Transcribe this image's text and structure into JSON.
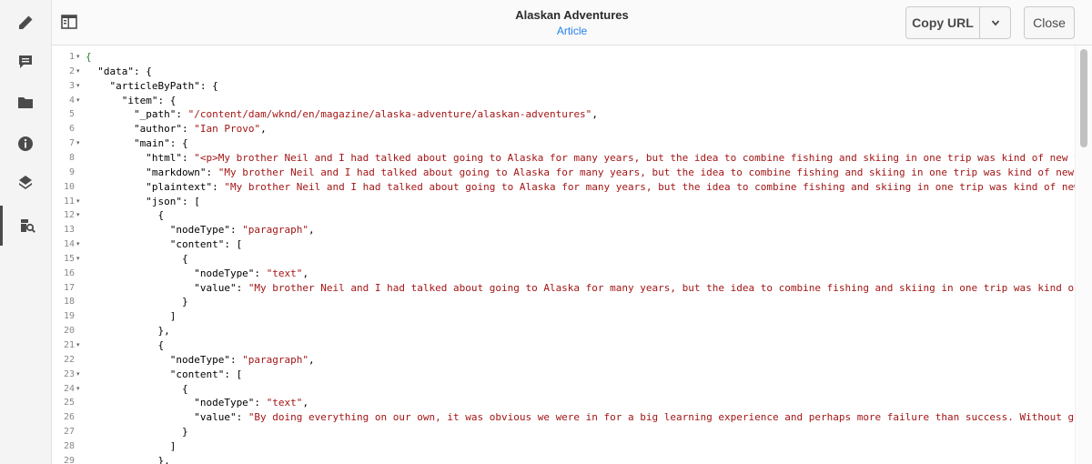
{
  "header": {
    "title": "Alaskan Adventures",
    "subtitle": "Article",
    "copy_url_label": "Copy URL",
    "close_label": "Close"
  },
  "rail": {
    "items": [
      {
        "name": "edit",
        "icon": "pencil-icon"
      },
      {
        "name": "annotations",
        "icon": "comment-icon"
      },
      {
        "name": "assets",
        "icon": "folder-icon"
      },
      {
        "name": "info",
        "icon": "info-icon"
      },
      {
        "name": "layers",
        "icon": "layers-icon"
      },
      {
        "name": "query-preview",
        "icon": "query-search-icon",
        "active": true
      }
    ]
  },
  "code": {
    "lines": [
      {
        "n": "1",
        "fold": true,
        "segs": [
          [
            "{",
            "g"
          ]
        ]
      },
      {
        "n": "2",
        "fold": true,
        "segs": [
          [
            "  \"data\": {",
            ""
          ]
        ]
      },
      {
        "n": "3",
        "fold": true,
        "segs": [
          [
            "    \"articleByPath\": {",
            ""
          ]
        ]
      },
      {
        "n": "4",
        "fold": true,
        "segs": [
          [
            "      \"item\": {",
            ""
          ]
        ]
      },
      {
        "n": "5",
        "fold": false,
        "segs": [
          [
            "        \"_path\": ",
            ""
          ],
          [
            "\"/content/dam/wknd/en/magazine/alaska-adventure/alaskan-adventures\"",
            "s"
          ],
          [
            ",",
            ""
          ]
        ]
      },
      {
        "n": "6",
        "fold": false,
        "segs": [
          [
            "        \"author\": ",
            ""
          ],
          [
            "\"Ian Provo\"",
            "s"
          ],
          [
            ",",
            ""
          ]
        ]
      },
      {
        "n": "7",
        "fold": true,
        "segs": [
          [
            "        \"main\": {",
            ""
          ]
        ]
      },
      {
        "n": "8",
        "fold": false,
        "segs": [
          [
            "          \"html\": ",
            ""
          ],
          [
            "\"<p>My brother Neil and I had talked about going to Alaska for many years, but the idea to combine fishing and skiing in one trip was kind of new to us. For t",
            "s"
          ]
        ]
      },
      {
        "n": "9",
        "fold": false,
        "segs": [
          [
            "          \"markdown\": ",
            ""
          ],
          [
            "\"My brother Neil and I had talked about going to Alaska for many years, but the idea to combine fishing and skiing in one trip was kind of new to us. For",
            "s"
          ]
        ]
      },
      {
        "n": "10",
        "fold": false,
        "segs": [
          [
            "          \"plaintext\": ",
            ""
          ],
          [
            "\"My brother Neil and I had talked about going to Alaska for many years, but the idea to combine fishing and skiing in one trip was kind of new to us. For",
            "s"
          ]
        ]
      },
      {
        "n": "11",
        "fold": true,
        "segs": [
          [
            "          \"json\": [",
            ""
          ]
        ]
      },
      {
        "n": "12",
        "fold": true,
        "segs": [
          [
            "            {",
            ""
          ]
        ]
      },
      {
        "n": "13",
        "fold": false,
        "segs": [
          [
            "              \"nodeType\": ",
            ""
          ],
          [
            "\"paragraph\"",
            "s"
          ],
          [
            ",",
            ""
          ]
        ]
      },
      {
        "n": "14",
        "fold": true,
        "segs": [
          [
            "              \"content\": [",
            ""
          ]
        ]
      },
      {
        "n": "15",
        "fold": true,
        "segs": [
          [
            "                {",
            ""
          ]
        ]
      },
      {
        "n": "16",
        "fold": false,
        "segs": [
          [
            "                  \"nodeType\": ",
            ""
          ],
          [
            "\"text\"",
            "s"
          ],
          [
            ",",
            ""
          ]
        ]
      },
      {
        "n": "17",
        "fold": false,
        "segs": [
          [
            "                  \"value\": ",
            ""
          ],
          [
            "\"My brother Neil and I had talked about going to Alaska for many years, but the idea to combine fishing and skiing in one trip was kind of new to us.",
            "s"
          ]
        ]
      },
      {
        "n": "18",
        "fold": false,
        "segs": [
          [
            "                }",
            ""
          ]
        ]
      },
      {
        "n": "19",
        "fold": false,
        "segs": [
          [
            "              ]",
            ""
          ]
        ]
      },
      {
        "n": "20",
        "fold": false,
        "segs": [
          [
            "            },",
            ""
          ]
        ]
      },
      {
        "n": "21",
        "fold": true,
        "segs": [
          [
            "            {",
            ""
          ]
        ]
      },
      {
        "n": "22",
        "fold": false,
        "segs": [
          [
            "              \"nodeType\": ",
            ""
          ],
          [
            "\"paragraph\"",
            "s"
          ],
          [
            ",",
            ""
          ]
        ]
      },
      {
        "n": "23",
        "fold": true,
        "segs": [
          [
            "              \"content\": [",
            ""
          ]
        ]
      },
      {
        "n": "24",
        "fold": true,
        "segs": [
          [
            "                {",
            ""
          ]
        ]
      },
      {
        "n": "25",
        "fold": false,
        "segs": [
          [
            "                  \"nodeType\": ",
            ""
          ],
          [
            "\"text\"",
            "s"
          ],
          [
            ",",
            ""
          ]
        ]
      },
      {
        "n": "26",
        "fold": false,
        "segs": [
          [
            "                  \"value\": ",
            ""
          ],
          [
            "\"By doing everything on our own, it was obvious we were in for a big learning experience and perhaps more failure than success. Without guides, or pl",
            "s"
          ]
        ]
      },
      {
        "n": "27",
        "fold": false,
        "segs": [
          [
            "                }",
            ""
          ]
        ]
      },
      {
        "n": "28",
        "fold": false,
        "segs": [
          [
            "              ]",
            ""
          ]
        ]
      },
      {
        "n": "29",
        "fold": false,
        "segs": [
          [
            "            },",
            ""
          ]
        ]
      }
    ]
  }
}
